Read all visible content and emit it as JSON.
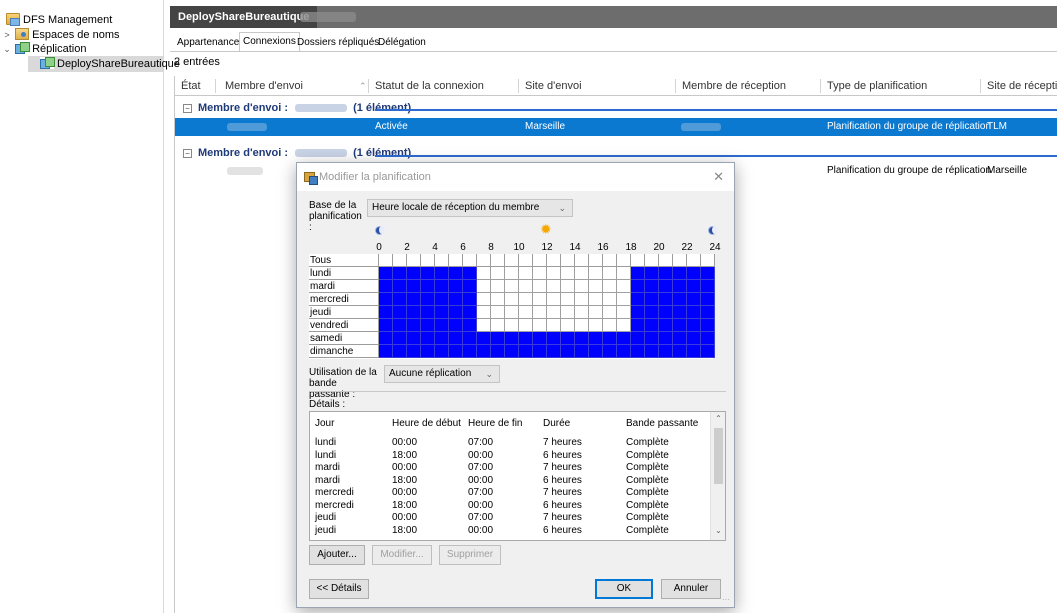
{
  "tree": {
    "root": "DFS Management",
    "namespaces": "Espaces de noms",
    "replication": "Réplication",
    "selected_group": "DeployShareBureautique"
  },
  "header": {
    "title": "DeployShareBureautique"
  },
  "tabs": [
    {
      "label": "Appartenances"
    },
    {
      "label": "Connexions"
    },
    {
      "label": "Dossiers répliqués"
    },
    {
      "label": "Délégation"
    }
  ],
  "entries_count": "2 entrées",
  "grid": {
    "columns": [
      "État",
      "Membre d'envoi",
      "Statut de la connexion",
      "Site d'envoi",
      "Membre de réception",
      "Type de planification",
      "Site de réception"
    ],
    "groups": [
      {
        "prefix": "Membre d'envoi :",
        "count": "(1 élément)",
        "row": {
          "status": "Activée",
          "site_envoi": "Marseille",
          "type": "Planification du groupe de réplication",
          "site_reception": "TLM"
        }
      },
      {
        "prefix": "Membre d'envoi :",
        "count": "(1 élément)",
        "row": {
          "status": "",
          "site_envoi": "",
          "type": "Planification du groupe de réplication",
          "site_reception": "Marseille"
        }
      }
    ]
  },
  "dialog": {
    "title": "Modifier la planification",
    "base_label": "Base de la planification :",
    "base_value": "Heure locale de réception du membre",
    "hours": [
      "0",
      "2",
      "4",
      "6",
      "8",
      "10",
      "12",
      "14",
      "16",
      "18",
      "20",
      "22",
      "24"
    ],
    "days": [
      "Tous",
      "lundi",
      "mardi",
      "mercredi",
      "jeudi",
      "vendredi",
      "samedi",
      "dimanche"
    ],
    "schedule": {
      "lundi": {
        "replication_hours": [
          [
            0,
            7
          ],
          [
            18,
            24
          ]
        ]
      },
      "mardi": {
        "replication_hours": [
          [
            0,
            7
          ],
          [
            18,
            24
          ]
        ]
      },
      "mercredi": {
        "replication_hours": [
          [
            0,
            7
          ],
          [
            18,
            24
          ]
        ]
      },
      "jeudi": {
        "replication_hours": [
          [
            0,
            7
          ],
          [
            18,
            24
          ]
        ]
      },
      "vendredi": {
        "replication_hours": [
          [
            0,
            7
          ],
          [
            18,
            24
          ]
        ]
      },
      "samedi": {
        "replication_hours": [
          [
            0,
            24
          ]
        ]
      },
      "dimanche": {
        "replication_hours": [
          [
            0,
            24
          ]
        ]
      }
    },
    "colors": {
      "replication": "#0000ff",
      "none": "#ffffff"
    },
    "bandwidth_label": "Utilisation de la bande passante :",
    "bandwidth_value": "Aucune réplication",
    "details_label": "Détails :",
    "details_columns": [
      "Jour",
      "Heure de début",
      "Heure de fin",
      "Durée",
      "Bande passante"
    ],
    "details_rows": [
      [
        "lundi",
        "00:00",
        "07:00",
        "7 heures",
        "Complète"
      ],
      [
        "lundi",
        "18:00",
        "00:00",
        "6 heures",
        "Complète"
      ],
      [
        "mardi",
        "00:00",
        "07:00",
        "7 heures",
        "Complète"
      ],
      [
        "mardi",
        "18:00",
        "00:00",
        "6 heures",
        "Complète"
      ],
      [
        "mercredi",
        "00:00",
        "07:00",
        "7 heures",
        "Complète"
      ],
      [
        "mercredi",
        "18:00",
        "00:00",
        "6 heures",
        "Complète"
      ],
      [
        "jeudi",
        "00:00",
        "07:00",
        "7 heures",
        "Complète"
      ],
      [
        "jeudi",
        "18:00",
        "00:00",
        "6 heures",
        "Complète"
      ]
    ],
    "buttons": {
      "add": "Ajouter...",
      "modify": "Modifier...",
      "delete": "Supprimer",
      "details": "<< Détails",
      "ok": "OK",
      "cancel": "Annuler"
    }
  }
}
